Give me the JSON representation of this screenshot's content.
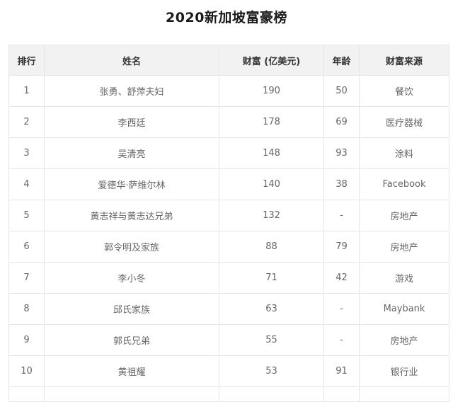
{
  "title": "2020新加坡富豪榜",
  "columns": [
    "排行",
    "姓名",
    "财富 (亿美元)",
    "年龄",
    "财富来源"
  ],
  "rows": [
    {
      "rank": "1",
      "name": "张勇、舒萍夫妇",
      "wealth": "190",
      "age": "50",
      "source": "餐饮"
    },
    {
      "rank": "2",
      "name": "李西廷",
      "wealth": "178",
      "age": "69",
      "source": "医疗器械"
    },
    {
      "rank": "3",
      "name": "吴清亮",
      "wealth": "148",
      "age": "93",
      "source": "涂料"
    },
    {
      "rank": "4",
      "name": "爱德华·萨维尔林",
      "wealth": "140",
      "age": "38",
      "source": "Facebook"
    },
    {
      "rank": "5",
      "name": "黄志祥与黄志达兄弟",
      "wealth": "132",
      "age": "-",
      "source": "房地产"
    },
    {
      "rank": "6",
      "name": "郭令明及家族",
      "wealth": "88",
      "age": "79",
      "source": "房地产"
    },
    {
      "rank": "7",
      "name": "李小冬",
      "wealth": "71",
      "age": "42",
      "source": "游戏"
    },
    {
      "rank": "8",
      "name": "邱氏家族",
      "wealth": "63",
      "age": "-",
      "source": "Maybank"
    },
    {
      "rank": "9",
      "name": "郭氏兄弟",
      "wealth": "55",
      "age": "-",
      "source": "房地产"
    },
    {
      "rank": "10",
      "name": "黄祖耀",
      "wealth": "53",
      "age": "91",
      "source": "银行业"
    }
  ]
}
